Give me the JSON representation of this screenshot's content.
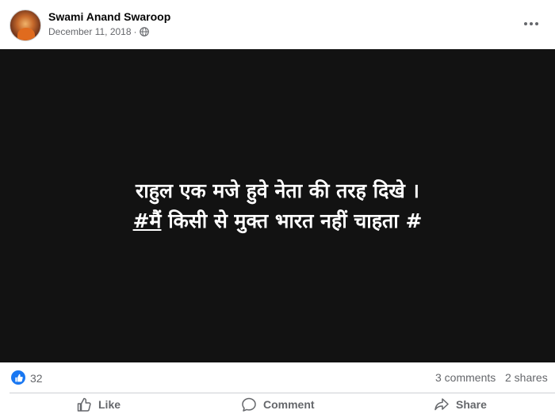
{
  "post": {
    "author": "Swami Anand Swaroop",
    "date": "December 11, 2018",
    "separator": "·",
    "privacy_icon": "globe-icon",
    "more_icon": "more-options-icon",
    "image_text": {
      "line1": "राहुल एक मजे हुवे नेता की तरह दिखे ।",
      "line2_hashtag": "#मैं",
      "line2_rest": " किसी से मुक्त भारत नहीं चाहता #"
    }
  },
  "stats": {
    "reaction_icon": "like-reaction-icon",
    "likes": "32",
    "comments": "3 comments",
    "shares": "2 shares"
  },
  "actions": {
    "like_label": "Like",
    "comment_label": "Comment",
    "share_label": "Share"
  },
  "colors": {
    "accent": "#1877f2",
    "image_bg": "#121212",
    "secondary_text": "#65676b"
  }
}
